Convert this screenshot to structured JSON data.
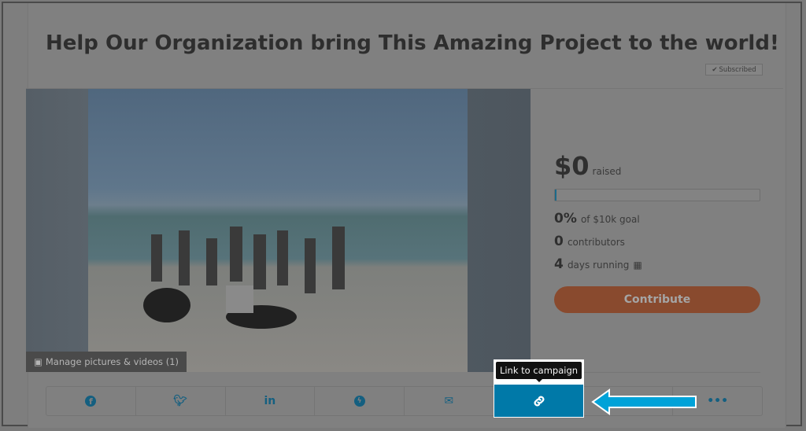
{
  "title": "Help Our Organization bring This Amazing Project to the world!",
  "subscribed": "Subscribed",
  "media": {
    "manage_label": "Manage pictures & videos (1)"
  },
  "stats": {
    "raised_amount": "$0",
    "raised_label": "raised",
    "progress_percent": 0,
    "percent": "0%",
    "goal_label": "of $10k goal",
    "contributors": "0",
    "contributors_label": "contributors",
    "days": "4",
    "days_label": "days running"
  },
  "contribute_label": "Contribute",
  "share": {
    "items": [
      "facebook-icon",
      "twitter-icon",
      "linkedin-icon",
      "messenger-icon",
      "email-icon",
      "link-icon",
      "",
      "more-icon"
    ],
    "tooltip": "Link to campaign"
  },
  "colors": {
    "highlight": "#0079a8",
    "arrow": "#00a2d8",
    "contribute": "#894a2e"
  }
}
